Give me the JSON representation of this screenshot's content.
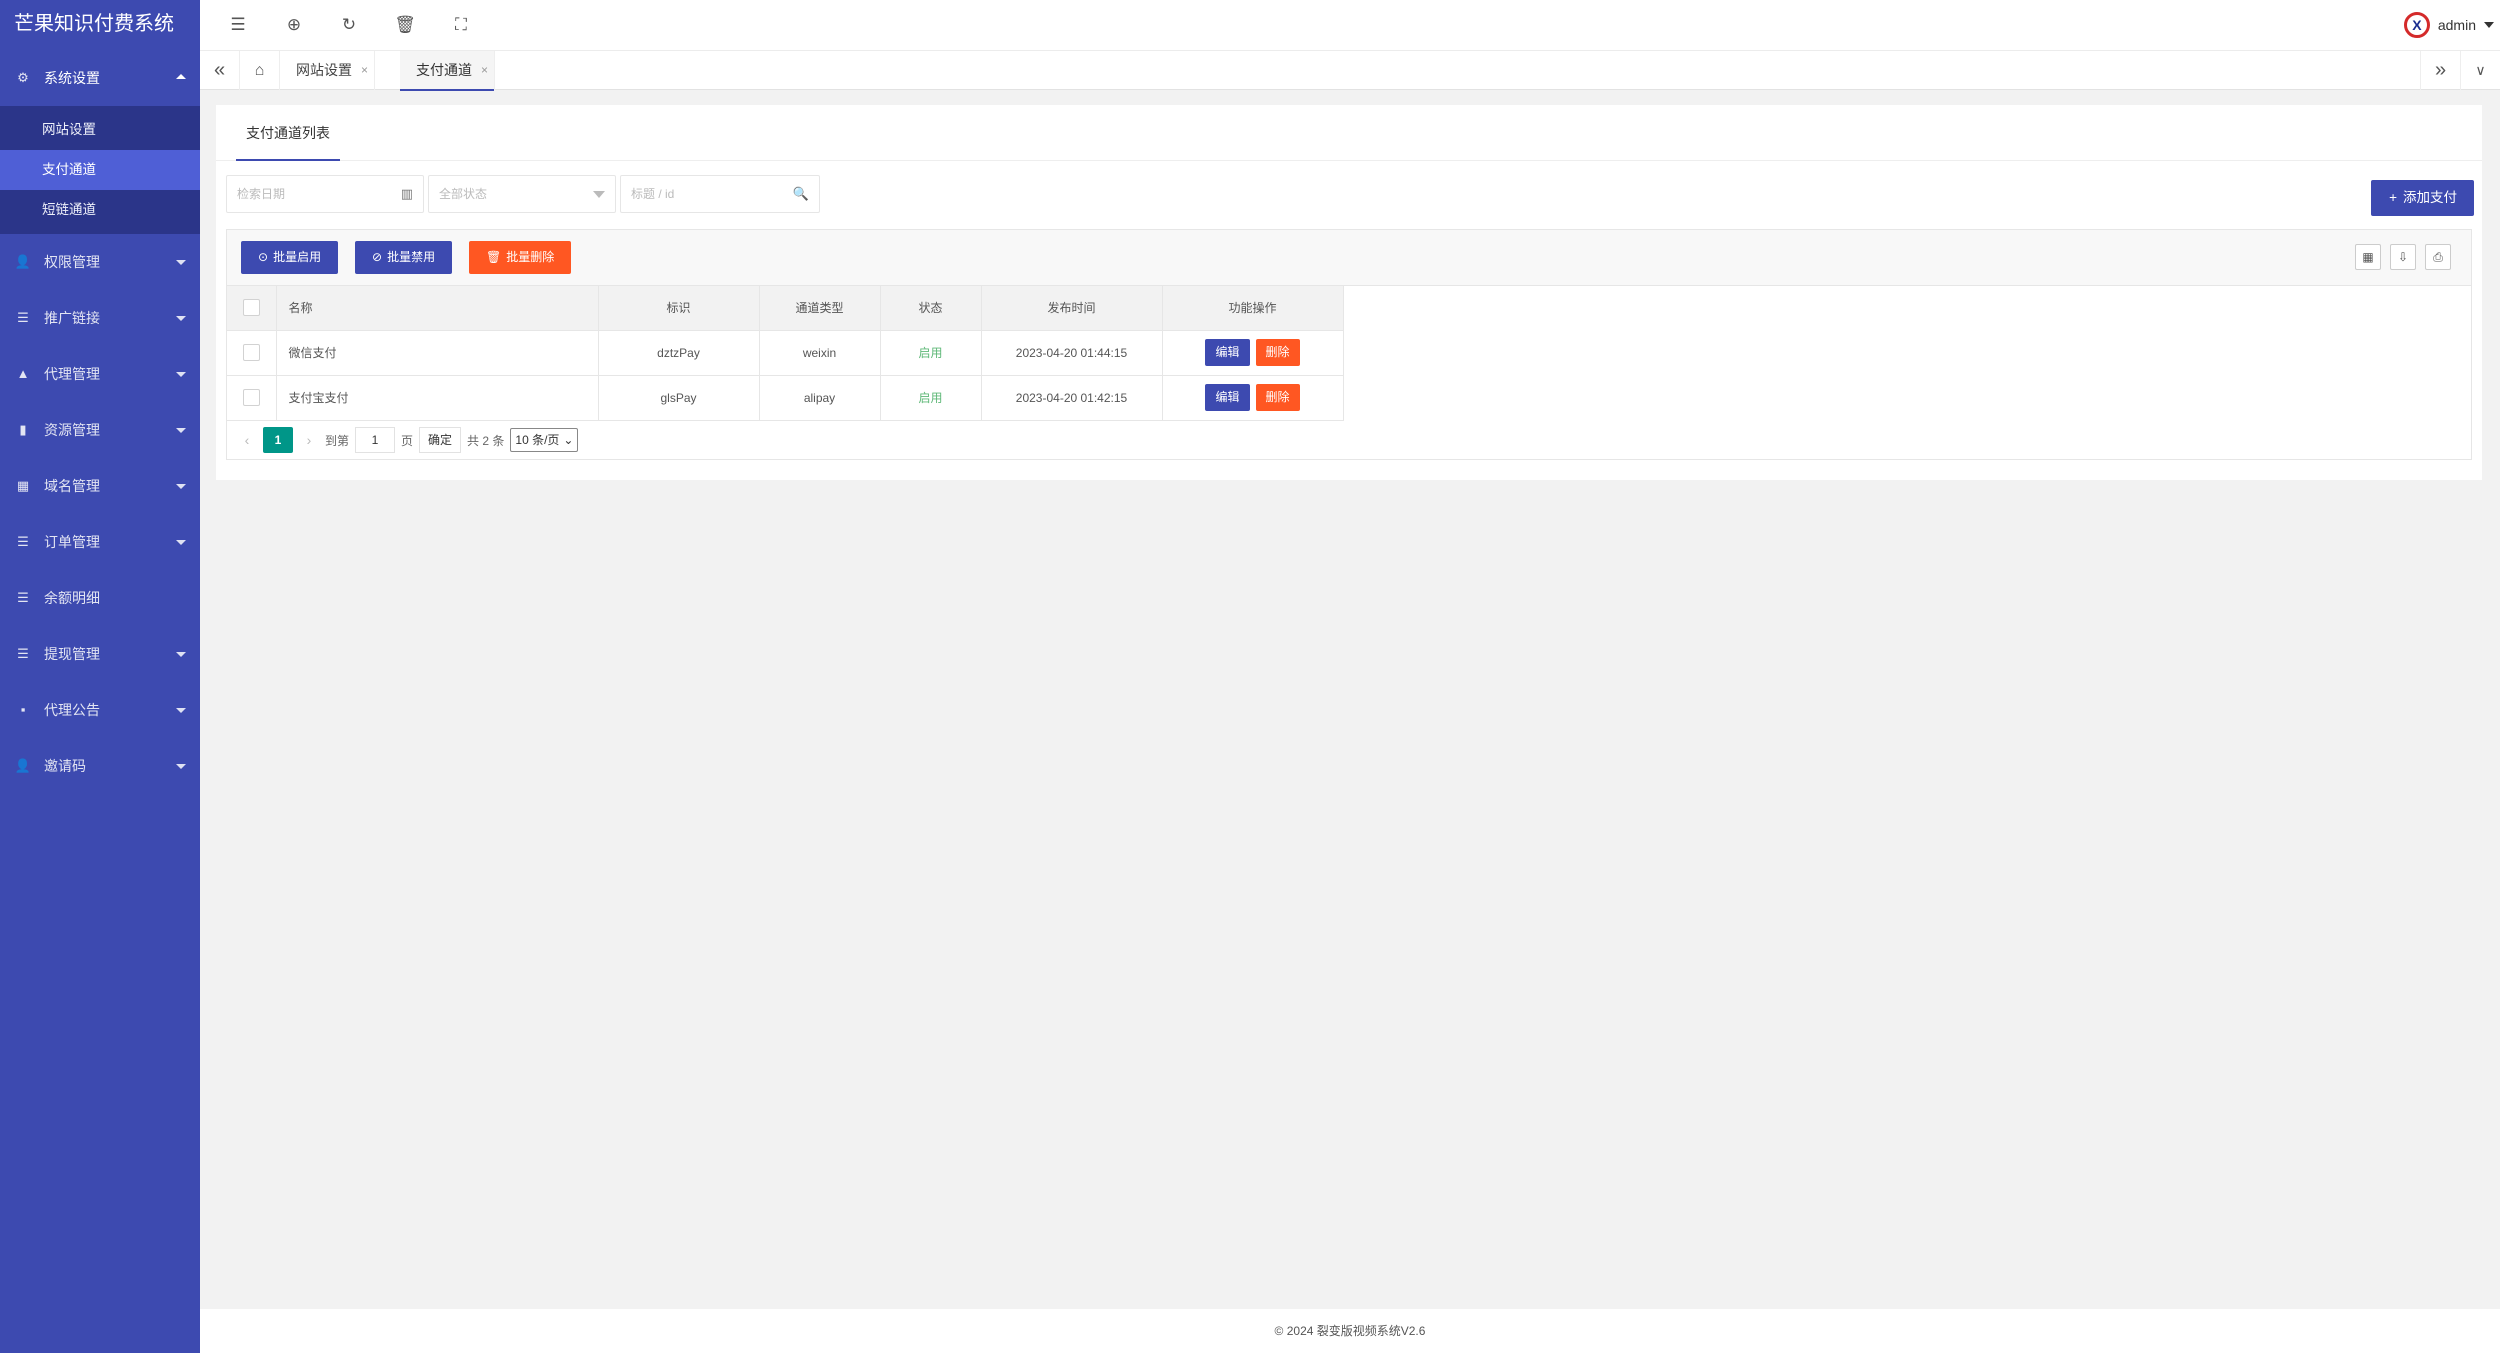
{
  "app": {
    "title": "芒果知识付费系统"
  },
  "sidebar": {
    "open_menu": {
      "label": "系统设置",
      "icon": "gear-icon"
    },
    "sub_items": [
      {
        "label": "网站设置"
      },
      {
        "label": "支付通道"
      },
      {
        "label": "短链通道"
      }
    ],
    "menus": [
      {
        "label": "权限管理",
        "icon": "users-icon"
      },
      {
        "label": "推广链接",
        "icon": "list-icon"
      },
      {
        "label": "代理管理",
        "icon": "people-icon"
      },
      {
        "label": "资源管理",
        "icon": "book-icon"
      },
      {
        "label": "域名管理",
        "icon": "grid-icon"
      },
      {
        "label": "订单管理",
        "icon": "list-icon"
      },
      {
        "label": "余额明细",
        "icon": "list-icon"
      },
      {
        "label": "提现管理",
        "icon": "list-icon"
      },
      {
        "label": "代理公告",
        "icon": "apps-icon"
      },
      {
        "label": "邀请码",
        "icon": "users-icon"
      }
    ]
  },
  "header": {
    "user": "admin"
  },
  "tabs": [
    {
      "label": "网站设置",
      "close": "×"
    },
    {
      "label": "支付通道",
      "close": "×"
    }
  ],
  "card": {
    "tab_label": "支付通道列表",
    "filters": {
      "date_placeholder": "检索日期",
      "status_placeholder": "全部状态",
      "keyword_placeholder": "标题 / id"
    },
    "add_button": "添加支付",
    "toolbar": {
      "enable": "批量启用",
      "disable": "批量禁用",
      "delete": "批量删除"
    },
    "columns": [
      "名称",
      "标识",
      "通道类型",
      "状态",
      "发布时间",
      "功能操作"
    ],
    "rows": [
      {
        "name": "微信支付",
        "code": "dztzPay",
        "type": "weixin",
        "status": "启用",
        "time": "2023-04-20 01:44:15",
        "edit": "编辑",
        "delete": "删除"
      },
      {
        "name": "支付宝支付",
        "code": "glsPay",
        "type": "alipay",
        "status": "启用",
        "time": "2023-04-20 01:42:15",
        "edit": "编辑",
        "delete": "删除"
      }
    ],
    "pager": {
      "current": "1",
      "goto_label": "到第",
      "page_value": "1",
      "page_unit": "页",
      "confirm": "确定",
      "total": "共 2 条",
      "page_size": "10 条/页"
    }
  },
  "footer": {
    "text": "© 2024 裂变版视频系统V2.6"
  }
}
